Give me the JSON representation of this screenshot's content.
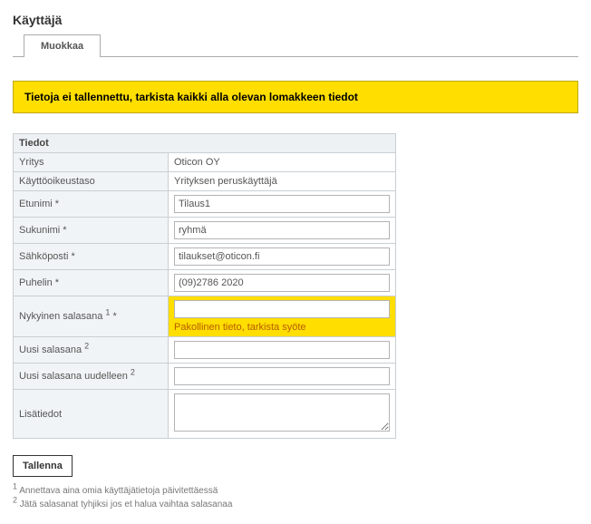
{
  "page_title": "Käyttäjä",
  "tab_edit": "Muokkaa",
  "alert": "Tietoja ei tallennettu, tarkista kaikki alla olevan lomakkeen tiedot",
  "section_title": "Tiedot",
  "labels": {
    "company": "Yritys",
    "access_level": "Käyttöoikeustaso",
    "first_name": "Etunimi *",
    "last_name": "Sukunimi *",
    "email": "Sähköposti *",
    "phone": "Puhelin *",
    "current_password_pre": "Nykyinen salasana ",
    "current_password_post": " *",
    "new_password_pre": "Uusi salasana ",
    "confirm_password_pre": "Uusi salasana uudelleen ",
    "notes": "Lisätiedot"
  },
  "values": {
    "company": "Oticon OY",
    "access_level": "Yrityksen peruskäyttäjä",
    "first_name": "Tilaus1",
    "last_name": "ryhmä",
    "email": "tilaukset@oticon.fi",
    "phone": "(09)2786 2020",
    "current_password": "",
    "new_password": "",
    "confirm_password": "",
    "notes": ""
  },
  "error_msg": "Pakollinen tieto, tarkista syöte",
  "save_label": "Tallenna",
  "footnote1": "Annettava aina omia käyttäjätietoja päivitettäessä",
  "footnote2": "Jätä salasanat tyhjiksi jos et halua vaihtaa salasanaa"
}
